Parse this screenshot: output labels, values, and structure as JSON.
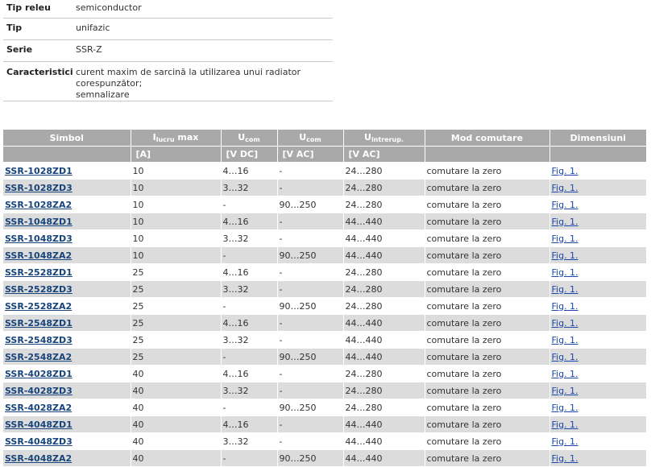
{
  "specs": [
    {
      "label": "Tip releu",
      "value": "semiconductor"
    },
    {
      "label": "Tip",
      "value": "unifazic"
    },
    {
      "label": "Serie",
      "value": "SSR-Z"
    },
    {
      "label": "Caracteristici",
      "value": "curent maxim de sarcină la utilizarea unui radiator corespunzător;",
      "value2": "semnalizare"
    }
  ],
  "table": {
    "headers": {
      "simbol": "Simbol",
      "ilucru_main": "I",
      "ilucru_sub": "lucru",
      "ilucru_tail": " max",
      "ucom_dc_main": "U",
      "ucom_dc_sub": "com",
      "ucom_ac_main": "U",
      "ucom_ac_sub": "com",
      "uint_main": "U",
      "uint_sub": "intrerup.",
      "mod": "Mod comutare",
      "dim": "Dimensiuni"
    },
    "units": {
      "ilucru": "[A]",
      "ucom_dc": "[V DC]",
      "ucom_ac": "[V AC]",
      "uint": "[V AC]"
    },
    "rows": [
      {
        "symbol": "SSR-1028ZD1",
        "i": "10",
        "udc": "4…16",
        "uac": "-",
        "uint": "24…280",
        "mode": "comutare la zero",
        "dim": "Fig. 1."
      },
      {
        "symbol": "SSR-1028ZD3",
        "i": "10",
        "udc": "3…32",
        "uac": "-",
        "uint": "24…280",
        "mode": "comutare la zero",
        "dim": "Fig. 1."
      },
      {
        "symbol": "SSR-1028ZA2",
        "i": "10",
        "udc": "-",
        "uac": "90…250",
        "uint": "24…280",
        "mode": "comutare la zero",
        "dim": "Fig. 1."
      },
      {
        "symbol": "SSR-1048ZD1",
        "i": "10",
        "udc": "4…16",
        "uac": "-",
        "uint": "44…440",
        "mode": "comutare la zero",
        "dim": "Fig. 1."
      },
      {
        "symbol": "SSR-1048ZD3",
        "i": "10",
        "udc": "3…32",
        "uac": "-",
        "uint": "44…440",
        "mode": "comutare la zero",
        "dim": "Fig. 1."
      },
      {
        "symbol": "SSR-1048ZA2",
        "i": "10",
        "udc": "-",
        "uac": "90…250",
        "uint": "44…440",
        "mode": "comutare la zero",
        "dim": "Fig. 1."
      },
      {
        "symbol": "SSR-2528ZD1",
        "i": "25",
        "udc": "4…16",
        "uac": "-",
        "uint": "24…280",
        "mode": "comutare la zero",
        "dim": "Fig. 1."
      },
      {
        "symbol": "SSR-2528ZD3",
        "i": "25",
        "udc": "3…32",
        "uac": "-",
        "uint": "24…280",
        "mode": "comutare la zero",
        "dim": "Fig. 1."
      },
      {
        "symbol": "SSR-2528ZA2",
        "i": "25",
        "udc": "-",
        "uac": "90…250",
        "uint": "24…280",
        "mode": "comutare la zero",
        "dim": "Fig. 1."
      },
      {
        "symbol": "SSR-2548ZD1",
        "i": "25",
        "udc": "4…16",
        "uac": "-",
        "uint": "44…440",
        "mode": "comutare la zero",
        "dim": "Fig. 1."
      },
      {
        "symbol": "SSR-2548ZD3",
        "i": "25",
        "udc": "3…32",
        "uac": "-",
        "uint": "44…440",
        "mode": "comutare la zero",
        "dim": "Fig. 1."
      },
      {
        "symbol": "SSR-2548ZA2",
        "i": "25",
        "udc": "-",
        "uac": "90…250",
        "uint": "44…440",
        "mode": "comutare la zero",
        "dim": "Fig. 1."
      },
      {
        "symbol": "SSR-4028ZD1",
        "i": "40",
        "udc": "4…16",
        "uac": "-",
        "uint": "24…280",
        "mode": "comutare la zero",
        "dim": "Fig. 1."
      },
      {
        "symbol": "SSR-4028ZD3",
        "i": "40",
        "udc": "3…32",
        "uac": "-",
        "uint": "24…280",
        "mode": "comutare la zero",
        "dim": "Fig. 1."
      },
      {
        "symbol": "SSR-4028ZA2",
        "i": "40",
        "udc": "-",
        "uac": "90…250",
        "uint": "24…280",
        "mode": "comutare la zero",
        "dim": "Fig. 1."
      },
      {
        "symbol": "SSR-4048ZD1",
        "i": "40",
        "udc": "4…16",
        "uac": "-",
        "uint": "44…440",
        "mode": "comutare la zero",
        "dim": "Fig. 1."
      },
      {
        "symbol": "SSR-4048ZD3",
        "i": "40",
        "udc": "3…32",
        "uac": "-",
        "uint": "44…440",
        "mode": "comutare la zero",
        "dim": "Fig. 1."
      },
      {
        "symbol": "SSR-4048ZA2",
        "i": "40",
        "udc": "-",
        "uac": "90…250",
        "uint": "44…440",
        "mode": "comutare la zero",
        "dim": "Fig. 1."
      }
    ]
  },
  "colors": {
    "header_bg": "#a9a9a9",
    "row_alt_bg": "#dcdcdc",
    "symbol_link": "#17447a",
    "fig_link": "#1a47a8"
  }
}
